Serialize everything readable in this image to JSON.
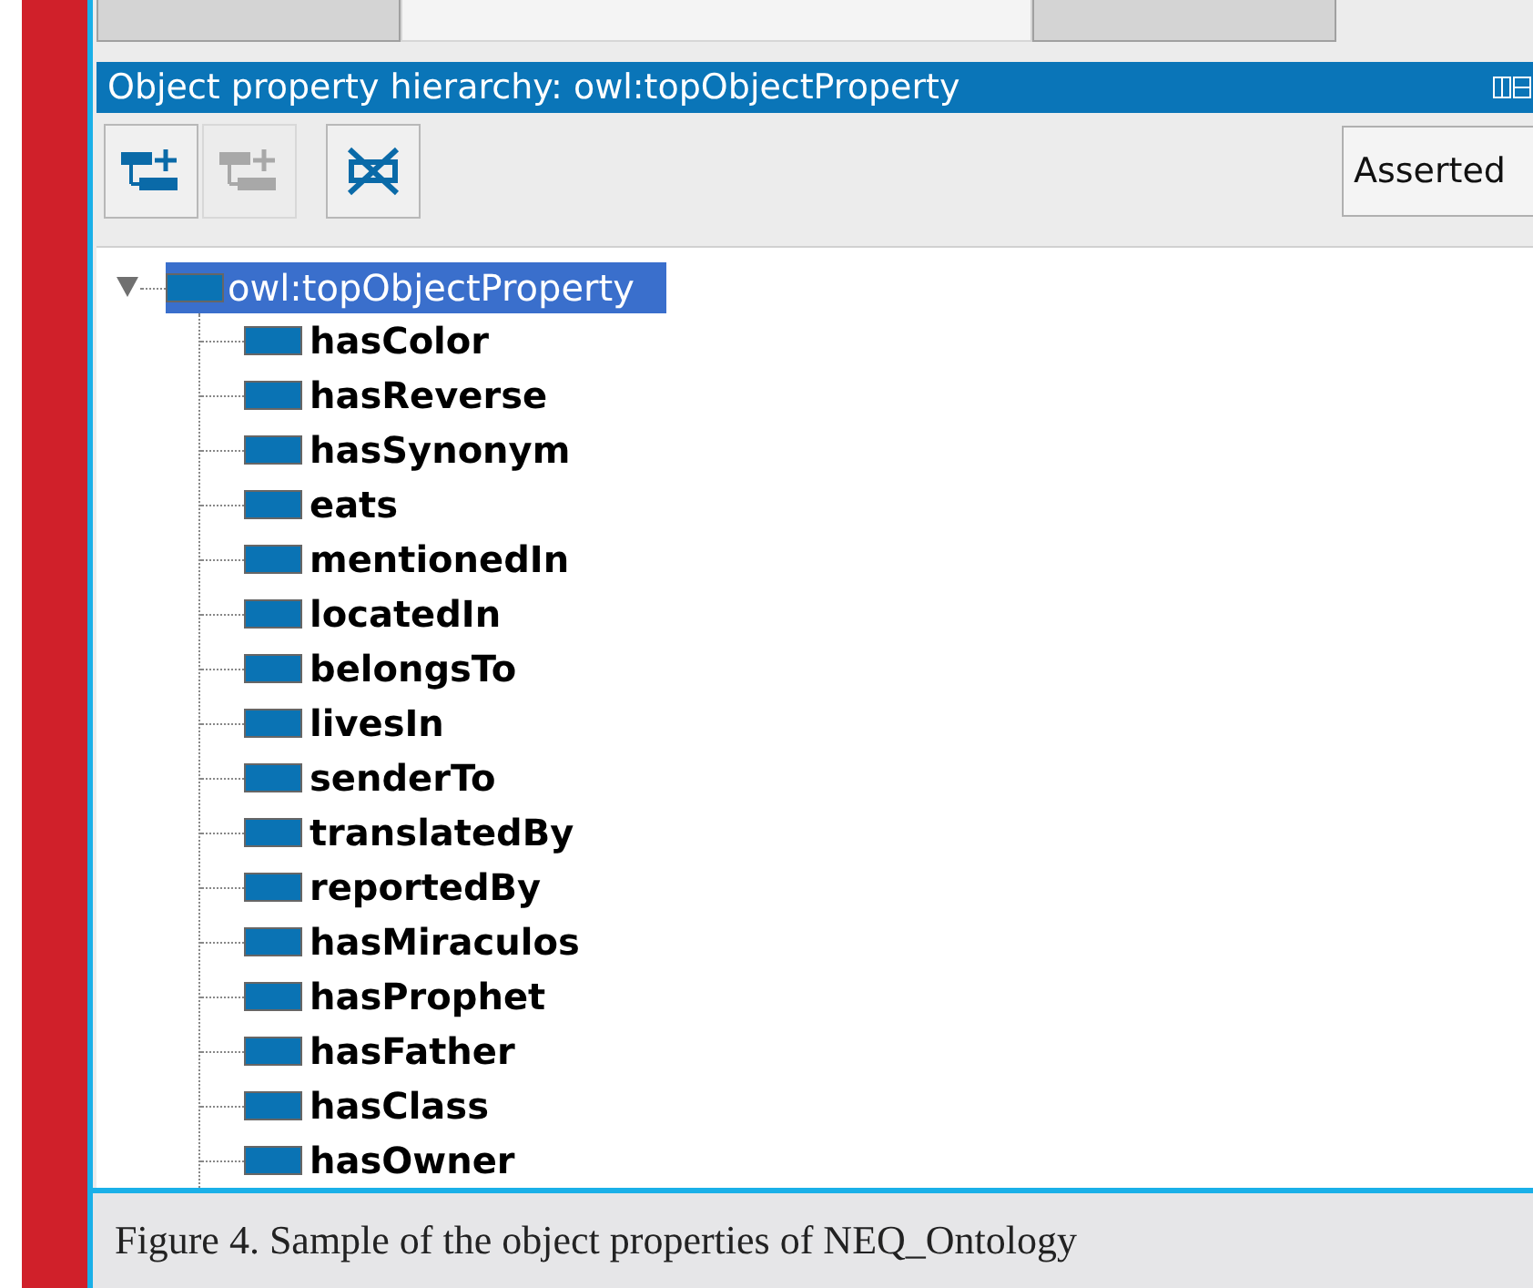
{
  "tabs": [
    {
      "selected": false
    },
    {
      "selected": true
    },
    {
      "selected": false
    }
  ],
  "panel": {
    "title": "Object property hierarchy: owl:topObjectProperty"
  },
  "toolbar": {
    "buttons": [
      {
        "kind": "add-sub",
        "disabled": false
      },
      {
        "kind": "add-sibling",
        "disabled": true
      },
      {
        "kind": "delete",
        "disabled": false
      }
    ],
    "view_button": "Asserted"
  },
  "tree": {
    "label": "owl:topObjectProperty",
    "selected": true,
    "expanded": true,
    "children": [
      {
        "label": "hasColor",
        "selected": false
      },
      {
        "label": "hasReverse",
        "selected": false
      },
      {
        "label": "hasSynonym",
        "selected": false
      },
      {
        "label": "eats",
        "selected": false
      },
      {
        "label": "mentionedIn",
        "selected": false
      },
      {
        "label": "locatedIn",
        "selected": false
      },
      {
        "label": "belongsTo",
        "selected": false
      },
      {
        "label": "livesIn",
        "selected": false
      },
      {
        "label": "senderTo",
        "selected": false
      },
      {
        "label": "translatedBy",
        "selected": false
      },
      {
        "label": "reportedBy",
        "selected": false
      },
      {
        "label": "hasMiraculos",
        "selected": false
      },
      {
        "label": "hasProphet",
        "selected": false
      },
      {
        "label": "hasFather",
        "selected": false
      },
      {
        "label": "hasClass",
        "selected": false
      },
      {
        "label": "hasOwner",
        "selected": false
      }
    ]
  },
  "caption": "Figure 4. Sample of the object properties of NEQ_Ontology"
}
